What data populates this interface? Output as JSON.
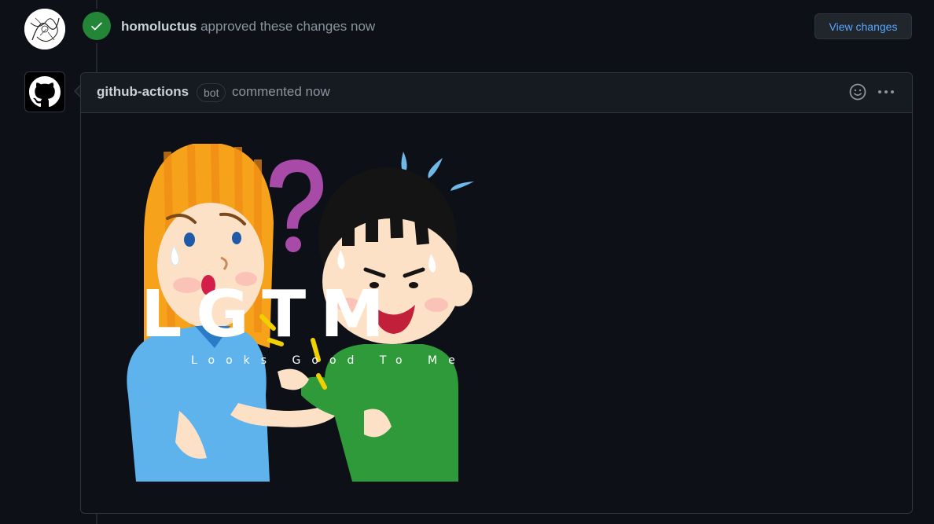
{
  "review": {
    "author": "homoluctus",
    "action": "approved these changes",
    "time": "now",
    "view_changes_label": "View changes"
  },
  "comment": {
    "author": "github-actions",
    "badge": "bot",
    "meta": "commented now",
    "image": {
      "title": "LGTM",
      "subtitle": "Looks Good To Me"
    }
  },
  "colors": {
    "approved_badge": "#238636",
    "link": "#58a6ff",
    "background": "#0d1117",
    "border": "#30363d"
  },
  "icons": {
    "approved": "check-icon",
    "bot_avatar": "github-mark-icon",
    "reaction": "smiley-icon",
    "menu": "kebab-horizontal-icon"
  }
}
